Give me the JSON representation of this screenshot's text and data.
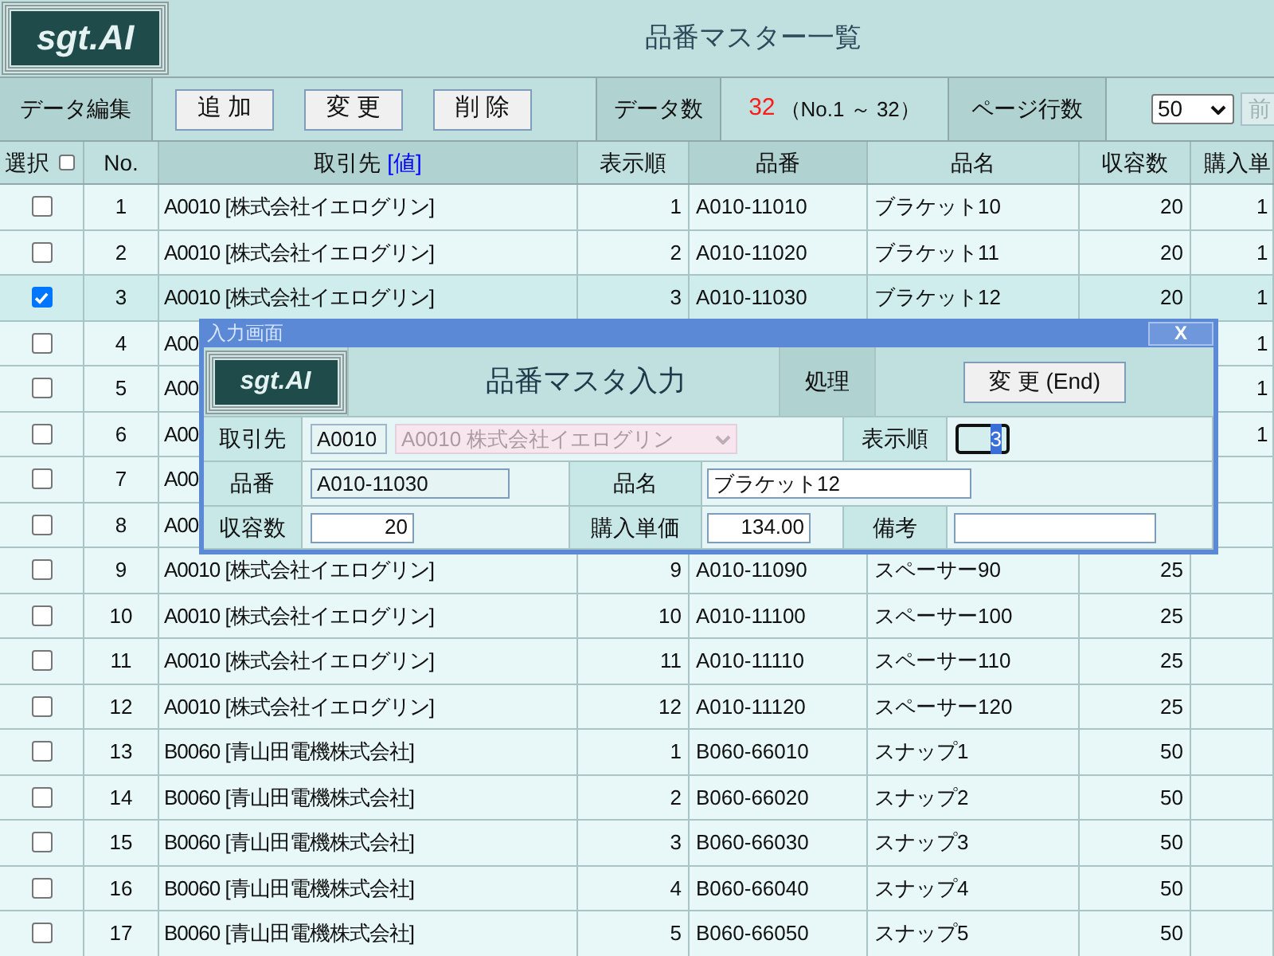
{
  "header": {
    "logo": "sgt.AI",
    "title": "品番マスター一覧"
  },
  "toolbar": {
    "edit_label": "データ編集",
    "buttons": [
      "追 加",
      "変 更",
      "削 除"
    ],
    "count_label": "データ数",
    "count": "32",
    "range": "（No.1 ～ 32）",
    "page_rows_label": "ページ行数",
    "page_rows": "50",
    "prev_button": {
      "label": "前",
      "disabled": true
    }
  },
  "table": {
    "select_all": {
      "checked": false
    },
    "columns": [
      {
        "label": "選択",
        "sort_key": false
      },
      {
        "label": "No.",
        "sort_key": false
      },
      {
        "label": "取引先",
        "link": "[値]",
        "sort_key": true
      },
      {
        "label": "表示順",
        "sort_key": false
      },
      {
        "label": "品番",
        "sort_key": true
      },
      {
        "label": "品名",
        "sort_key": false
      },
      {
        "label": "収容数",
        "sort_key": false
      },
      {
        "label": "購入単",
        "sort_key": false
      }
    ],
    "rows": [
      {
        "selected": false,
        "checked": false,
        "no": "1",
        "customer": "A0010 [株式会社イエログリン]",
        "order": "1",
        "part_no": "A010-11010",
        "part_name": "ブラケット10",
        "quantity": "20",
        "column_8": "1"
      },
      {
        "selected": false,
        "checked": false,
        "no": "2",
        "customer": "A0010 [株式会社イエログリン]",
        "order": "2",
        "part_no": "A010-11020",
        "part_name": "ブラケット11",
        "quantity": "20",
        "column_8": "1"
      },
      {
        "selected": true,
        "checked": true,
        "no": "3",
        "customer": "A0010 [株式会社イエログリン]",
        "order": "3",
        "part_no": "A010-11030",
        "part_name": "ブラケット12",
        "quantity": "20",
        "column_8": "1"
      },
      {
        "selected": false,
        "checked": false,
        "no": "4",
        "customer": "A00",
        "column_8": "1"
      },
      {
        "selected": false,
        "checked": false,
        "no": "5",
        "customer": "A00",
        "column_8": "1"
      },
      {
        "selected": false,
        "checked": false,
        "no": "6",
        "customer": "A00",
        "column_8": "1"
      },
      {
        "selected": false,
        "checked": false,
        "no": "7",
        "customer": "A00"
      },
      {
        "selected": false,
        "checked": false,
        "no": "8",
        "customer": "A00"
      },
      {
        "selected": false,
        "checked": false,
        "no": "9",
        "customer": "A0010 [株式会社イエログリン]",
        "order": "9",
        "part_no": "A010-11090",
        "part_name": "スペーサー90",
        "quantity": "25"
      },
      {
        "selected": false,
        "checked": false,
        "no": "10",
        "customer": "A0010 [株式会社イエログリン]",
        "order": "10",
        "part_no": "A010-11100",
        "part_name": "スペーサー100",
        "quantity": "25"
      },
      {
        "selected": false,
        "checked": false,
        "no": "11",
        "customer": "A0010 [株式会社イエログリン]",
        "order": "11",
        "part_no": "A010-11110",
        "part_name": "スペーサー110",
        "quantity": "25"
      },
      {
        "selected": false,
        "checked": false,
        "no": "12",
        "customer": "A0010 [株式会社イエログリン]",
        "order": "12",
        "part_no": "A010-11120",
        "part_name": "スペーサー120",
        "quantity": "25"
      },
      {
        "selected": false,
        "checked": false,
        "no": "13",
        "customer": "B0060 [青山田電機株式会社]",
        "order": "1",
        "part_no": "B060-66010",
        "part_name": "スナップ1",
        "quantity": "50"
      },
      {
        "selected": false,
        "checked": false,
        "no": "14",
        "customer": "B0060 [青山田電機株式会社]",
        "order": "2",
        "part_no": "B060-66020",
        "part_name": "スナップ2",
        "quantity": "50"
      },
      {
        "selected": false,
        "checked": false,
        "no": "15",
        "customer": "B0060 [青山田電機株式会社]",
        "order": "3",
        "part_no": "B060-66030",
        "part_name": "スナップ3",
        "quantity": "50"
      },
      {
        "selected": false,
        "checked": false,
        "no": "16",
        "customer": "B0060 [青山田電機株式会社]",
        "order": "4",
        "part_no": "B060-66040",
        "part_name": "スナップ4",
        "quantity": "50"
      },
      {
        "selected": false,
        "checked": false,
        "no": "17",
        "customer": "B0060 [青山田電機株式会社]",
        "order": "5",
        "part_no": "B060-66050",
        "part_name": "スナップ5",
        "quantity": "50"
      }
    ]
  },
  "dialog": {
    "title": "入力画面",
    "close": "X",
    "logo": "sgt.AI",
    "heading": "品番マスタ入力",
    "action_label": "処理",
    "action_button": "変 更 (End)",
    "customer": {
      "label": "取引先",
      "code": "A0010",
      "name": "A0010 株式会社イエログリン",
      "disabled": true
    },
    "display_order": {
      "label": "表示順",
      "value": "3",
      "focused": true
    },
    "part_no": {
      "label": "品番",
      "value": "A010-11030",
      "readonly": true
    },
    "part_name": {
      "label": "品名",
      "value": "ブラケット12"
    },
    "quantity": {
      "label": "収容数",
      "value": "20"
    },
    "unit_price": {
      "label": "購入単価",
      "value": "134.00"
    },
    "remarks": {
      "label": "備考"
    }
  }
}
